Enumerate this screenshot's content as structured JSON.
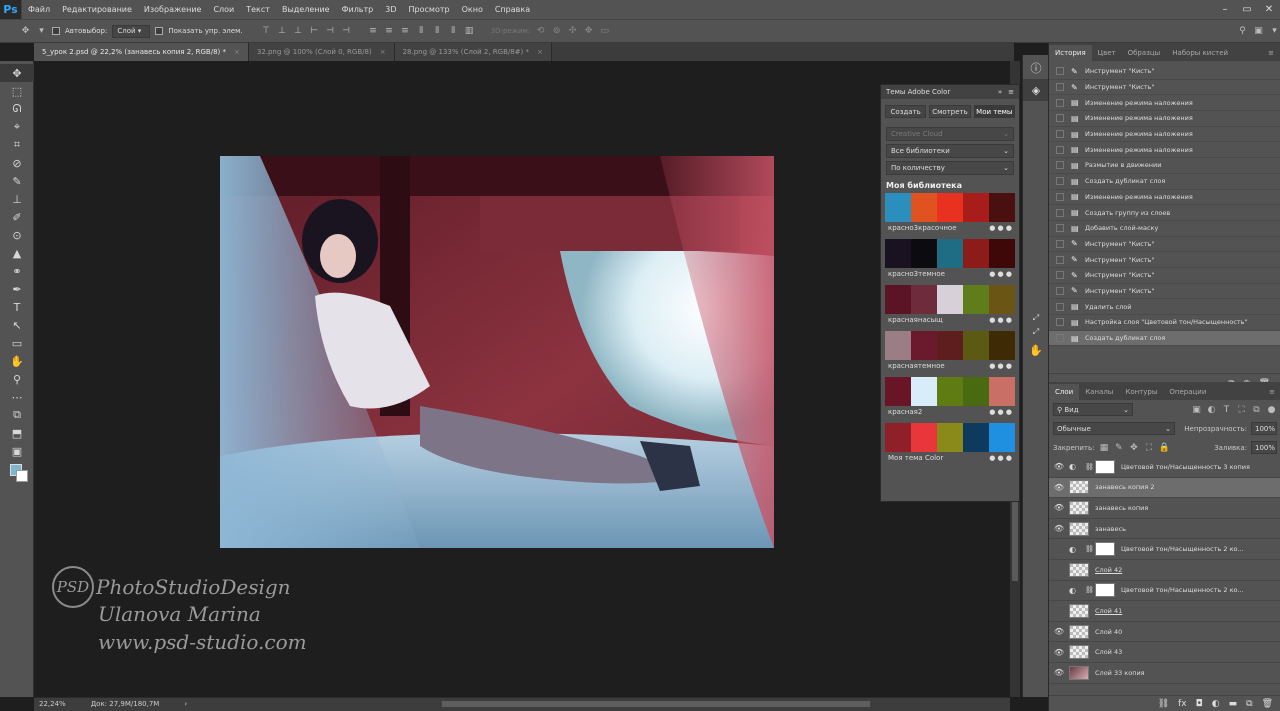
{
  "app": {
    "logo": "Ps"
  },
  "menu": [
    "Файл",
    "Редактирование",
    "Изображение",
    "Слои",
    "Текст",
    "Выделение",
    "Фильтр",
    "3D",
    "Просмотр",
    "Окно",
    "Справка"
  ],
  "window_controls": [
    "–",
    "▭",
    "✕"
  ],
  "options": {
    "autoselect_label": "Автовыбор:",
    "autoselect_value": "Слой",
    "show_controls_label": "Показать упр. элем.",
    "mode_3d": "3D-режим:"
  },
  "tabs": [
    {
      "label": "5_урок 2.psd @ 22,2% (занавесь копия 2, RGB/8) *",
      "close": "×"
    },
    {
      "label": "32.png @ 100% (Слой 0, RGB/8)",
      "close": "×"
    },
    {
      "label": "28.png @ 133% (Слой 2, RGB/8#) *",
      "close": "×"
    }
  ],
  "tools": [
    "✥",
    "⬚",
    "ᘏ",
    "⌖",
    "⌗",
    "⊘",
    "✎",
    "⊥",
    "✐",
    "⊙",
    "▲",
    "⚭",
    "✒",
    "T",
    "↖",
    "▭",
    "✋",
    "⚲",
    "⋯",
    "⧉",
    "⬒",
    "▣"
  ],
  "watermark": {
    "psd": "PSD",
    "line1": "PhotoStudioDesign",
    "line2": "Ulanova Marina",
    "line3": "www.psd-studio.com"
  },
  "color_panel": {
    "title": "Темы Adobe Color",
    "tabs": [
      "Создать",
      "Смотреть",
      "Мои темы"
    ],
    "dropdown1": "Creative Cloud",
    "dropdown2": "Все библиотеки",
    "dropdown3": "По количеству",
    "library_heading": "Моя библиотека",
    "themes": [
      {
        "name": "красно3красочное",
        "colors": [
          "#2a8fbd",
          "#e0521f",
          "#e9311f",
          "#a81c1a",
          "#4a0f0f"
        ]
      },
      {
        "name": "красно3темное",
        "colors": [
          "#1a1220",
          "#0b0b10",
          "#1f6d85",
          "#8c1c17",
          "#3e0808"
        ]
      },
      {
        "name": "краснаянасыщ",
        "colors": [
          "#5b1426",
          "#6e2b3b",
          "#d7d0d8",
          "#5f7d1a",
          "#6b5514"
        ]
      },
      {
        "name": "краснаятемное",
        "colors": [
          "#9b7d86",
          "#6b1a2e",
          "#5e1e1e",
          "#5c5a12",
          "#3f2a06"
        ]
      },
      {
        "name": "красная2",
        "colors": [
          "#6a1428",
          "#d9ecfa",
          "#5e7c12",
          "#4a6a12",
          "#c96f66"
        ]
      },
      {
        "name": "Моя тема Color",
        "colors": [
          "#8f1f28",
          "#e8363a",
          "#8a8a1a",
          "#0e3a5e",
          "#1f8fe0"
        ]
      }
    ],
    "more": "● ● ●"
  },
  "dock_icons": [
    "ⓘ",
    "✎",
    "⤢",
    "⤢",
    "⤢",
    "✋"
  ],
  "history": {
    "tabs": [
      "История",
      "Цвет",
      "Образцы",
      "Наборы кистей"
    ],
    "items": [
      {
        "icon": "brush",
        "label": "Инструмент \"Кисть\""
      },
      {
        "icon": "brush",
        "label": "Инструмент \"Кисть\""
      },
      {
        "icon": "doc",
        "label": "Изменение режима наложения"
      },
      {
        "icon": "doc",
        "label": "Изменение режима наложения"
      },
      {
        "icon": "doc",
        "label": "Изменение режима наложения"
      },
      {
        "icon": "doc",
        "label": "Изменение режима наложения"
      },
      {
        "icon": "doc",
        "label": "Размытие в движении"
      },
      {
        "icon": "doc",
        "label": "Создать дубликат слоя"
      },
      {
        "icon": "doc",
        "label": "Изменение режима наложения"
      },
      {
        "icon": "doc",
        "label": "Создать группу из слоев"
      },
      {
        "icon": "doc",
        "label": "Добавить слой-маску"
      },
      {
        "icon": "brush",
        "label": "Инструмент \"Кисть\""
      },
      {
        "icon": "brush",
        "label": "Инструмент \"Кисть\""
      },
      {
        "icon": "brush",
        "label": "Инструмент \"Кисть\""
      },
      {
        "icon": "brush",
        "label": "Инструмент \"Кисть\""
      },
      {
        "icon": "doc",
        "label": "Удалить слой"
      },
      {
        "icon": "doc",
        "label": "Настройка слоя \"Цветовой тон/Насыщенность\""
      },
      {
        "icon": "doc",
        "label": "Создать дубликат слоя"
      }
    ]
  },
  "layers": {
    "tabs": [
      "Слои",
      "Каналы",
      "Контуры",
      "Операции"
    ],
    "filter": "Вид",
    "blend": "Обычные",
    "opacity_label": "Непрозрачность:",
    "opacity": "100%",
    "lock_label": "Закрепить:",
    "fill_label": "Заливка:",
    "fill": "100%",
    "items": [
      {
        "name": "Цветовой тон/Насыщенность 3 копия",
        "visible": true,
        "type": "adj",
        "underline": false
      },
      {
        "name": "занавесь копия 2",
        "visible": true,
        "type": "pix",
        "underline": false,
        "selected": true
      },
      {
        "name": "занавесь копия",
        "visible": true,
        "type": "pix",
        "underline": false
      },
      {
        "name": "занавесь",
        "visible": true,
        "type": "pix",
        "underline": false
      },
      {
        "name": "Цветовой тон/Насыщенность 2 ко...",
        "visible": false,
        "type": "adj",
        "underline": false
      },
      {
        "name": "Слой 42",
        "visible": false,
        "type": "pix",
        "underline": true
      },
      {
        "name": "Цветовой тон/Насыщенность 2 ко...",
        "visible": false,
        "type": "adj",
        "underline": false
      },
      {
        "name": "Слой 41",
        "visible": false,
        "type": "pix",
        "underline": true
      },
      {
        "name": "Слой 40",
        "visible": true,
        "type": "pix",
        "underline": false
      },
      {
        "name": "Слой 43",
        "visible": true,
        "type": "pix",
        "underline": false
      },
      {
        "name": "Слой 33 копия",
        "visible": true,
        "type": "photo",
        "underline": false
      }
    ]
  },
  "status": {
    "zoom": "22,24%",
    "doc": "Док: 27,9M/180,7M"
  }
}
